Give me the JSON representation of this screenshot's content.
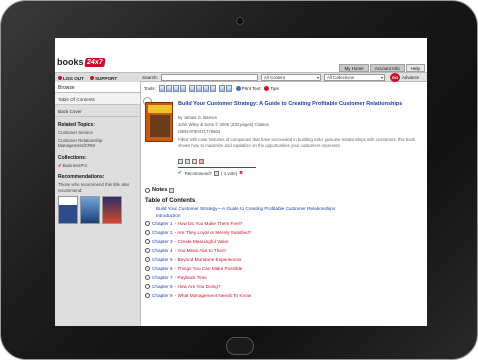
{
  "header": {
    "brand": "books",
    "brand_suffix": "24x7",
    "tabs": [
      "My Home",
      "Account Info",
      "Help"
    ]
  },
  "nav": {
    "log_out": "LOG OUT",
    "support": "SUPPORT",
    "search_label": "Search:",
    "search_value": "",
    "filter_content": "All Content",
    "filter_collection": "All Collections",
    "go": "GO",
    "advanced": "Advance"
  },
  "sidebar": {
    "browse": "Browse",
    "items": [
      "Table Of Contents",
      "Back Cover"
    ],
    "related_heading": "Related Topics:",
    "related": [
      "Customer Service",
      "Customer Relationship Management/CRM"
    ],
    "collections_heading": "Collections:",
    "collection": "BusinessPro",
    "recommend_heading": "Recommendations:",
    "recommend_text": "Those who recommend this title also recommend:"
  },
  "tools": {
    "label": "Tools:",
    "print_text": "Print Text",
    "tips": "Tips"
  },
  "book": {
    "title": "Build Your Customer Strategy: A Guide to Creating Profitable Customer Relationships",
    "author": "by  James G. Barnes",
    "publisher": "John Wiley & Sons © 2006 (230 pages)  Citation",
    "isbn": "ISBN:9780471776604",
    "description": "Filled with case histories of companies that have succeeded in building solid, genuine relationships with customers, this book shows how to maximize and capitalize on the opportunities your customers represent.",
    "recommend": "Recommend?",
    "votes": "( 1 vote)"
  },
  "main": {
    "notes": "Notes",
    "toc_heading": "Table of Contents",
    "toc_links": [
      "Build Your Customer Strategy—A Guide to Creating Profitable Customer Relationships",
      "Introduction"
    ],
    "chapters": [
      {
        "num": "Chapter 1",
        "title": " - How Do You Make Them Feel?"
      },
      {
        "num": "Chapter 2",
        "title": " - Are They Loyal or Merely Satisfied?"
      },
      {
        "num": "Chapter 3",
        "title": " - Create Meaningful Value"
      },
      {
        "num": "Chapter 4",
        "title": " - You Mean Alot to Them"
      },
      {
        "num": "Chapter 5",
        "title": " - Beyond Mundane Experiences"
      },
      {
        "num": "Chapter 6",
        "title": " - Things You Can Make Possible"
      },
      {
        "num": "Chapter 7",
        "title": " - Payback Time"
      },
      {
        "num": "Chapter 8",
        "title": " - How Are You Doing?"
      },
      {
        "num": "Chapter 9",
        "title": " - What Management Needs To Know"
      }
    ]
  },
  "colors": {
    "accent": "#c8102e",
    "link": "#1a3fa8",
    "sidebar": "#dedede"
  }
}
